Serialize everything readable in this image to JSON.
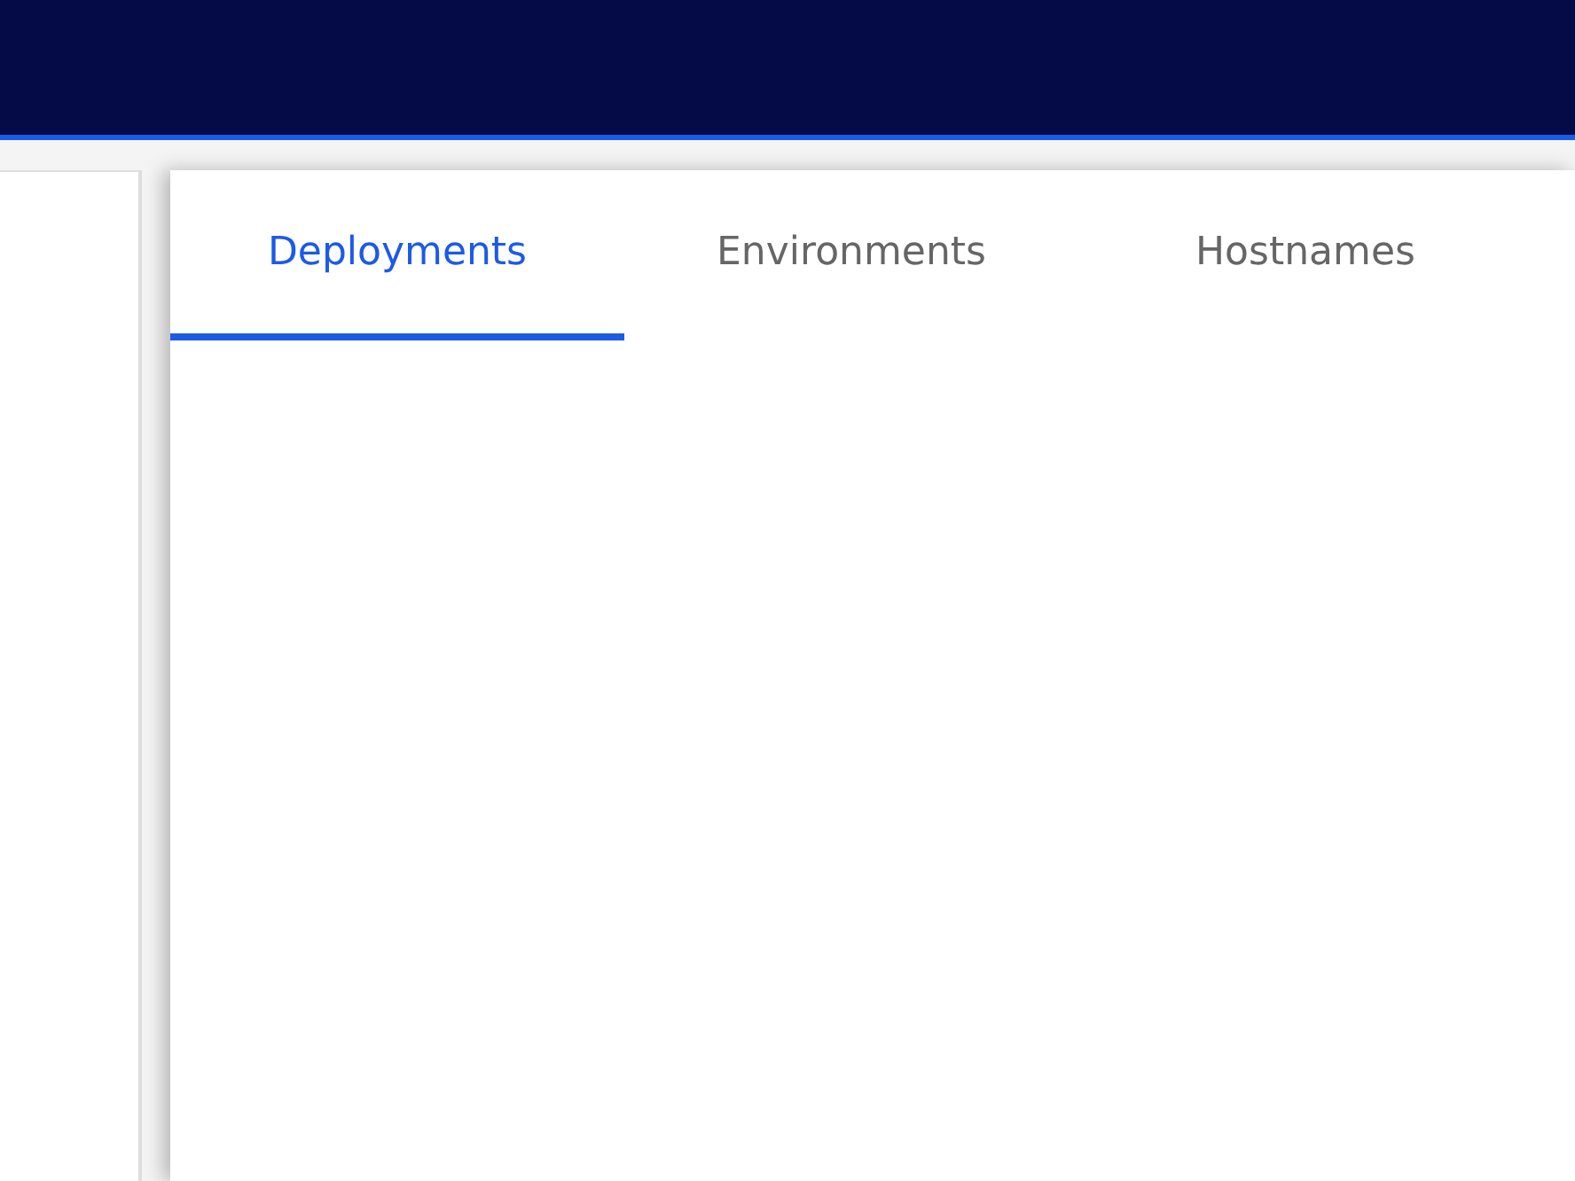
{
  "tabs": [
    {
      "label": "Deployments",
      "selected": true
    },
    {
      "label": "Environments",
      "selected": false
    },
    {
      "label": "Hostnames",
      "selected": false
    }
  ]
}
